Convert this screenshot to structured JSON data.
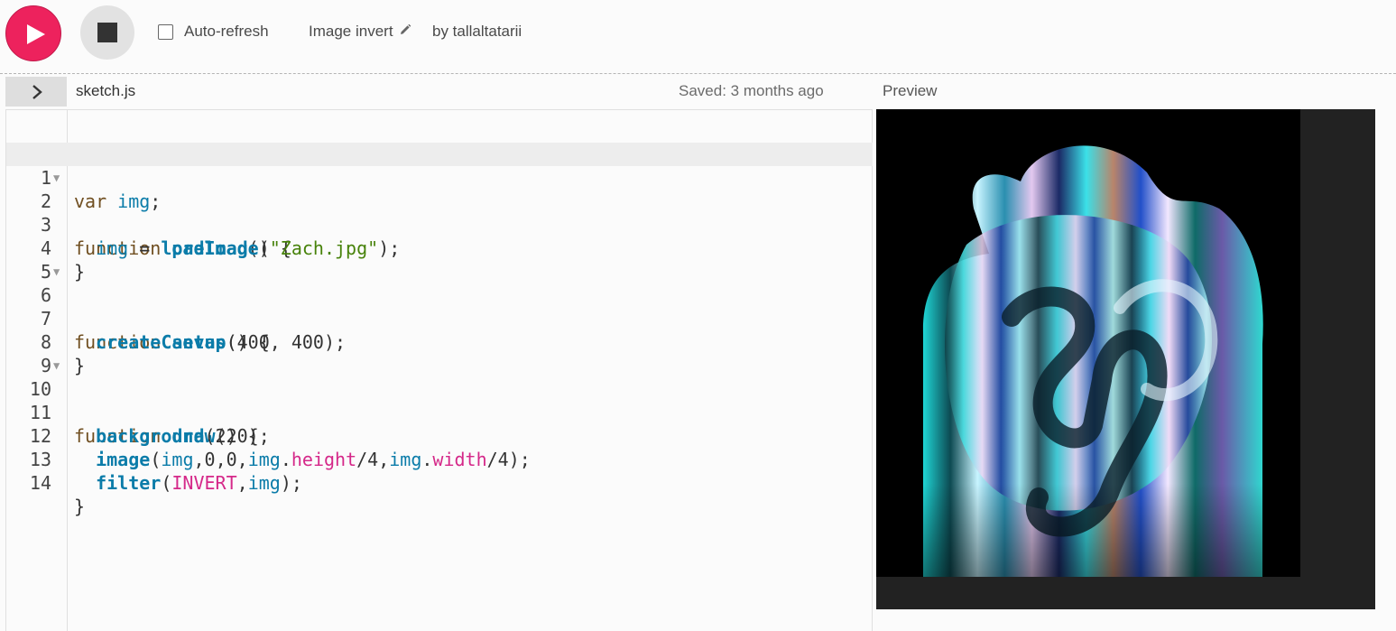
{
  "toolbar": {
    "auto_refresh_label": "Auto-refresh",
    "auto_refresh_checked": false,
    "project_name": "Image invert",
    "byline": "by tallaltatarii"
  },
  "editor": {
    "file_name": "sketch.js",
    "saved_status": "Saved: 3 months ago",
    "lines": [
      {
        "n": "1"
      },
      {
        "n": "2"
      },
      {
        "n": "3"
      },
      {
        "n": "4"
      },
      {
        "n": "5"
      },
      {
        "n": "6"
      },
      {
        "n": "7"
      },
      {
        "n": "8"
      },
      {
        "n": "9"
      },
      {
        "n": "10"
      },
      {
        "n": "11"
      },
      {
        "n": "12"
      },
      {
        "n": "13"
      },
      {
        "n": "14"
      }
    ],
    "code": {
      "l1_kw": "var",
      "l1_var": "img",
      "l1_end": ";",
      "l2_kw": "function",
      "l2_fn": "preload",
      "l2_end": "() {",
      "l3_var": "img",
      "l3_eq": " = ",
      "l3_fn": "loadImage",
      "l3_open": "(",
      "l3_str": "\"Zach.jpg\"",
      "l3_end": ");",
      "l4": "}",
      "l6_kw": "function",
      "l6_fn": "setup",
      "l6_end": "() {",
      "l7_fn": "createCanvas",
      "l7_args": "(400, 400);",
      "l8": "}",
      "l10_kw": "function",
      "l10_fn": "draw",
      "l10_end": "() {",
      "l11_fn": "background",
      "l11_args": "(220);",
      "l12_fn": "image",
      "l12_a": "(",
      "l12_b": "img",
      "l12_c": ",0,0,",
      "l12_d": "img",
      "l12_e": ".",
      "l12_f": "height",
      "l12_g": "/4,",
      "l12_h": "img",
      "l12_i": ".",
      "l12_j": "width",
      "l12_k": "/4);",
      "l13_fn": "filter",
      "l13_a": "(",
      "l13_b": "INVERT",
      "l13_c": ",",
      "l13_d": "img",
      "l13_e": ");",
      "l14": "}"
    }
  },
  "preview": {
    "label": "Preview"
  },
  "colors": {
    "play_button": "#ed225d",
    "keyword": "#704f21",
    "function": "#0b7ca9",
    "string": "#47820a",
    "property": "#d52889"
  },
  "icons": {
    "play": "play-icon",
    "stop": "stop-icon",
    "pencil": "pencil-icon",
    "expand": "chevron-right-icon"
  }
}
